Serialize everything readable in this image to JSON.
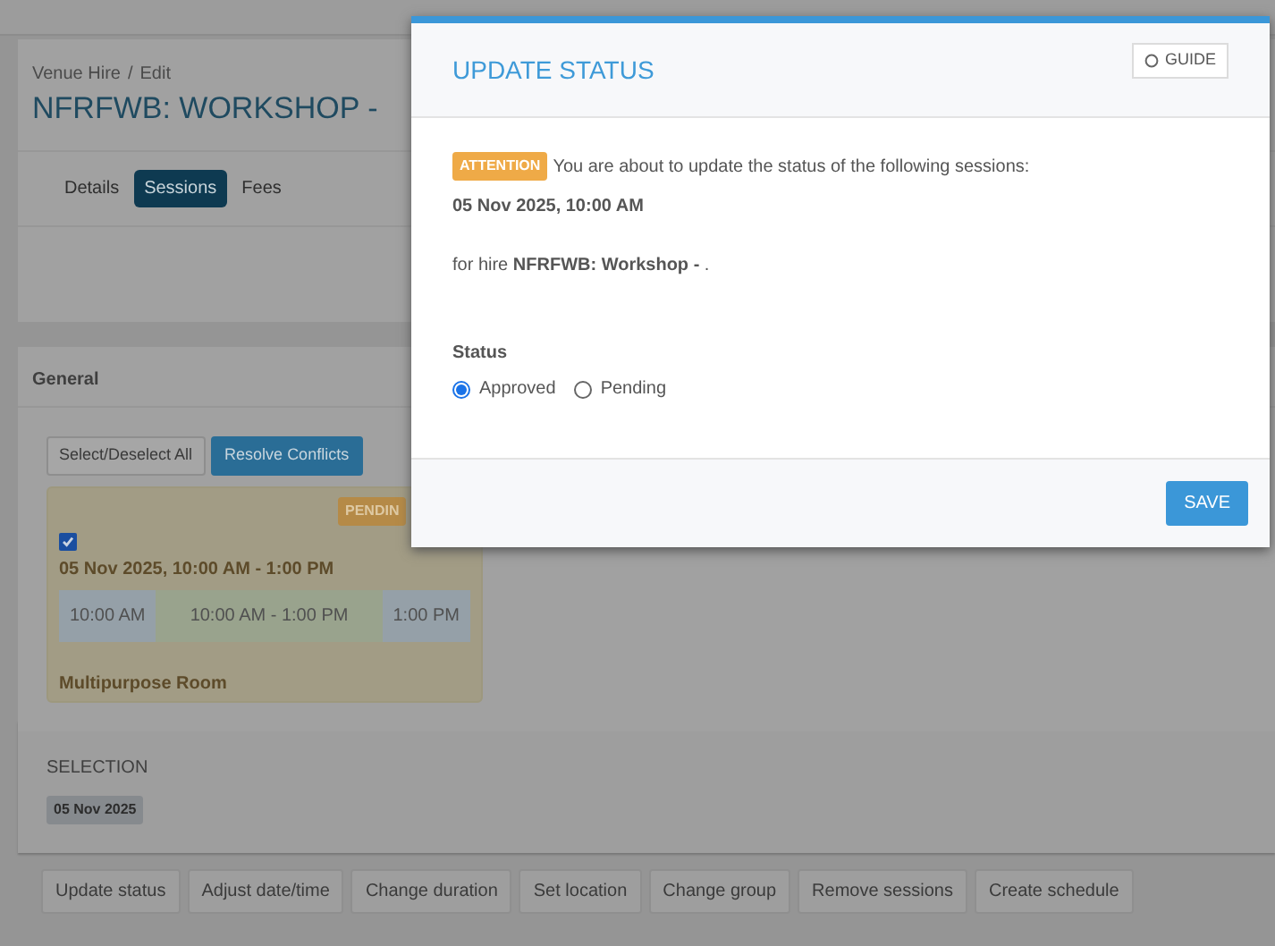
{
  "breadcrumb": [
    "Venue Hire",
    "Edit"
  ],
  "breadcrumb_separator": "/",
  "title": "NFRFWB: WORKSHOP -",
  "tabs": [
    {
      "label": "Details",
      "selected": false
    },
    {
      "label": "Sessions",
      "selected": true
    },
    {
      "label": "Fees",
      "selected": false
    }
  ],
  "general": {
    "heading": "General",
    "buttons": [
      {
        "label": "Select/Deselect All",
        "kind": "plain"
      },
      {
        "label": "Resolve Conflicts",
        "kind": "primary"
      }
    ],
    "session": {
      "status": "PENDIN",
      "checked": true,
      "datetime": "05 Nov 2025, 10:00 AM - 1:00 PM",
      "timeline": [
        "10:00 AM",
        "10:00 AM - 1:00 PM",
        "1:00 PM"
      ],
      "location": "Multipurpose Room"
    }
  },
  "selection": {
    "heading": "SELECTION",
    "tags": [
      "05 Nov 2025"
    ]
  },
  "actions": [
    "Update status",
    "Adjust date/time",
    "Change duration",
    "Set location",
    "Change group",
    "Remove sessions",
    "Create schedule"
  ],
  "modal": {
    "title": "UPDATE STATUS",
    "guide": "GUIDE",
    "badge": "ATTENTION",
    "message": "You are about to update the status of the following sessions:",
    "sessions": [
      "05 Nov 2025, 10:00 AM"
    ],
    "hire": "for hire **NFRFWB: Workshop -** .",
    "status_label": "Status",
    "options": [
      {
        "label": "Approved",
        "selected": true
      },
      {
        "label": "Pending",
        "selected": false
      }
    ],
    "save": "SAVE"
  }
}
